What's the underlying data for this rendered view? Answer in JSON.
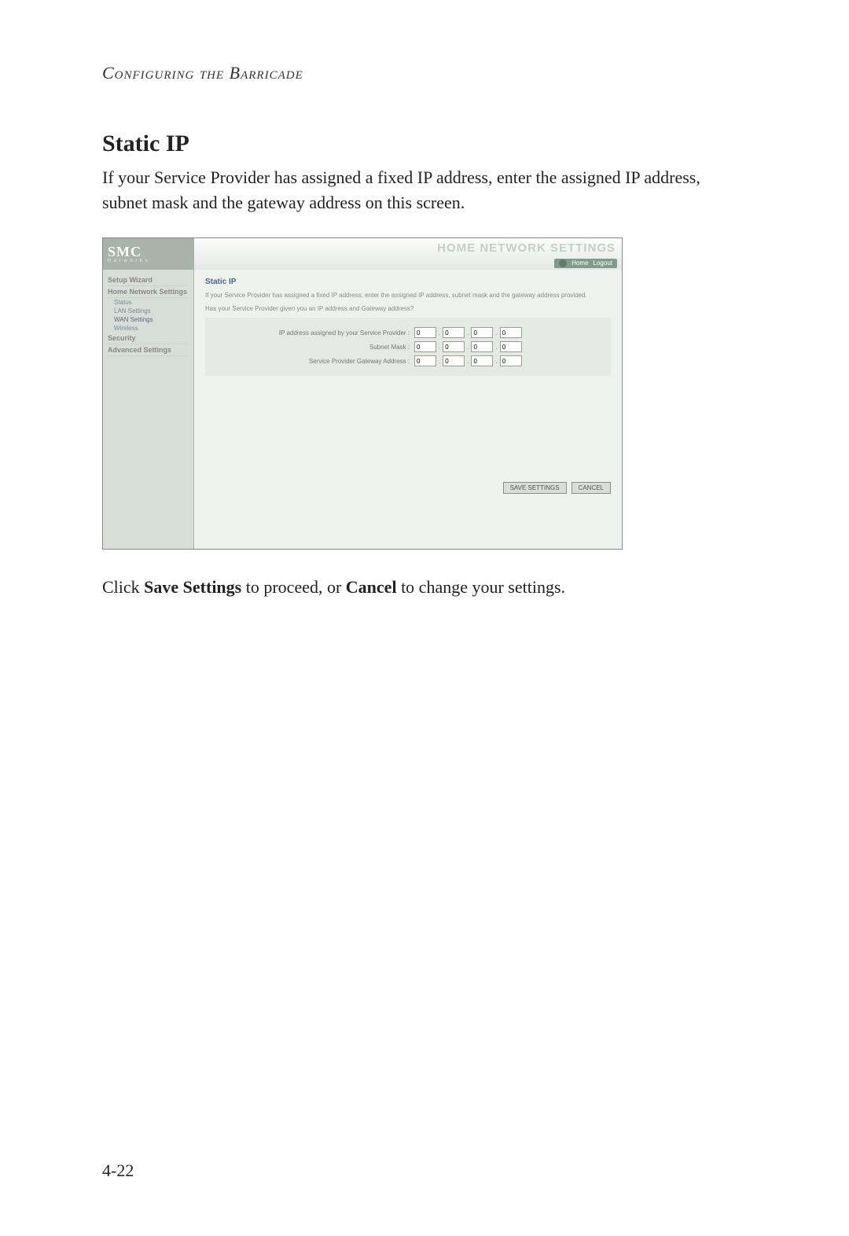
{
  "doc": {
    "running_head": "Configuring the Barricade",
    "section_title": "Static IP",
    "intro": "If your Service Provider has assigned a fixed IP address, enter the assigned IP address, subnet mask and the gateway address on this screen.",
    "outro_pre": "Click ",
    "outro_b1": "Save Settings",
    "outro_mid": " to proceed, or ",
    "outro_b2": "Cancel",
    "outro_post": " to change your settings.",
    "page_number": "4-22"
  },
  "ui": {
    "logo": "SMC",
    "logo_sub": "N e t w o r k s",
    "top_title": "HOME NETWORK SETTINGS",
    "links": {
      "home": "Home",
      "logout": "Logout"
    },
    "nav": {
      "setup_wizard": "Setup Wizard",
      "home_network_settings": "Home Network Settings",
      "status": "Status",
      "lan": "LAN Settings",
      "wan": "WAN Settings",
      "wireless": "Wireless",
      "security": "Security",
      "advanced": "Advanced Settings"
    },
    "panel": {
      "heading": "Static IP",
      "help1": "If your Service Provider has assigned a fixed IP address; enter the assigned IP address, subnet mask and the gateway address provided.",
      "help2": "Has your Service Provider given you an IP address and Gateway address?",
      "labels": {
        "ip": "IP address assigned by your Service Provider :",
        "mask": "Subnet Mask :",
        "gw": "Service Provider Gateway Address :"
      },
      "octet": "0",
      "buttons": {
        "save": "SAVE SETTINGS",
        "cancel": "CANCEL"
      }
    }
  }
}
